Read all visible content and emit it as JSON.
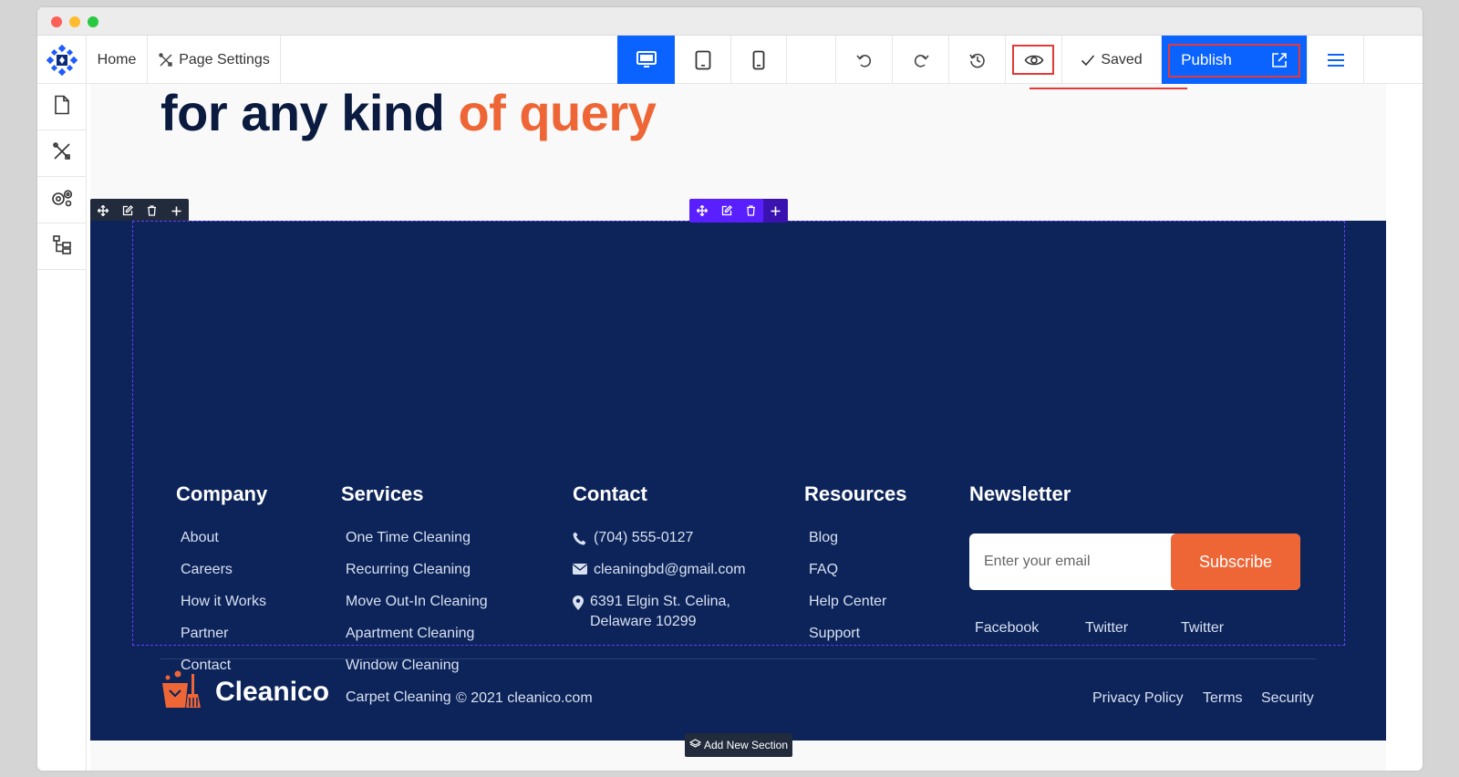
{
  "toolbar": {
    "home_label": "Home",
    "page_settings_label": "Page Settings",
    "saved_label": "Saved",
    "publish_label": "Publish",
    "accent_color": "#0a63ff",
    "highlight_color": "#e53935"
  },
  "hero": {
    "text_main": "for any kind ",
    "text_accent": "of query",
    "accent_color": "#ee6636"
  },
  "footer": {
    "background_color": "#0c245a",
    "company": {
      "heading": "Company",
      "links": [
        "About",
        "Careers",
        "How it Works",
        "Partner",
        "Contact"
      ]
    },
    "services": {
      "heading": "Services",
      "links": [
        "One Time Cleaning",
        "Recurring Cleaning",
        "Move Out-In Cleaning",
        "Apartment Cleaning",
        "Window Cleaning",
        "Carpet Cleaning"
      ]
    },
    "contact": {
      "heading": "Contact",
      "phone": "(704) 555-0127",
      "email": "cleaningbd@gmail.com",
      "address": "6391 Elgin St. Celina, Delaware 10299"
    },
    "resources": {
      "heading": "Resources",
      "links": [
        "Blog",
        "FAQ",
        "Help Center",
        "Support"
      ]
    },
    "newsletter": {
      "heading": "Newsletter",
      "placeholder": "Enter your email",
      "button_label": "Subscribe",
      "social": [
        "Facebook",
        "Twitter",
        "Twitter"
      ]
    },
    "brand_name": "Cleanico",
    "copyright": "© 2021 cleanico.com",
    "legal_links": [
      "Privacy Policy",
      "Terms",
      "Security"
    ]
  },
  "add_section_label": "Add New Section"
}
